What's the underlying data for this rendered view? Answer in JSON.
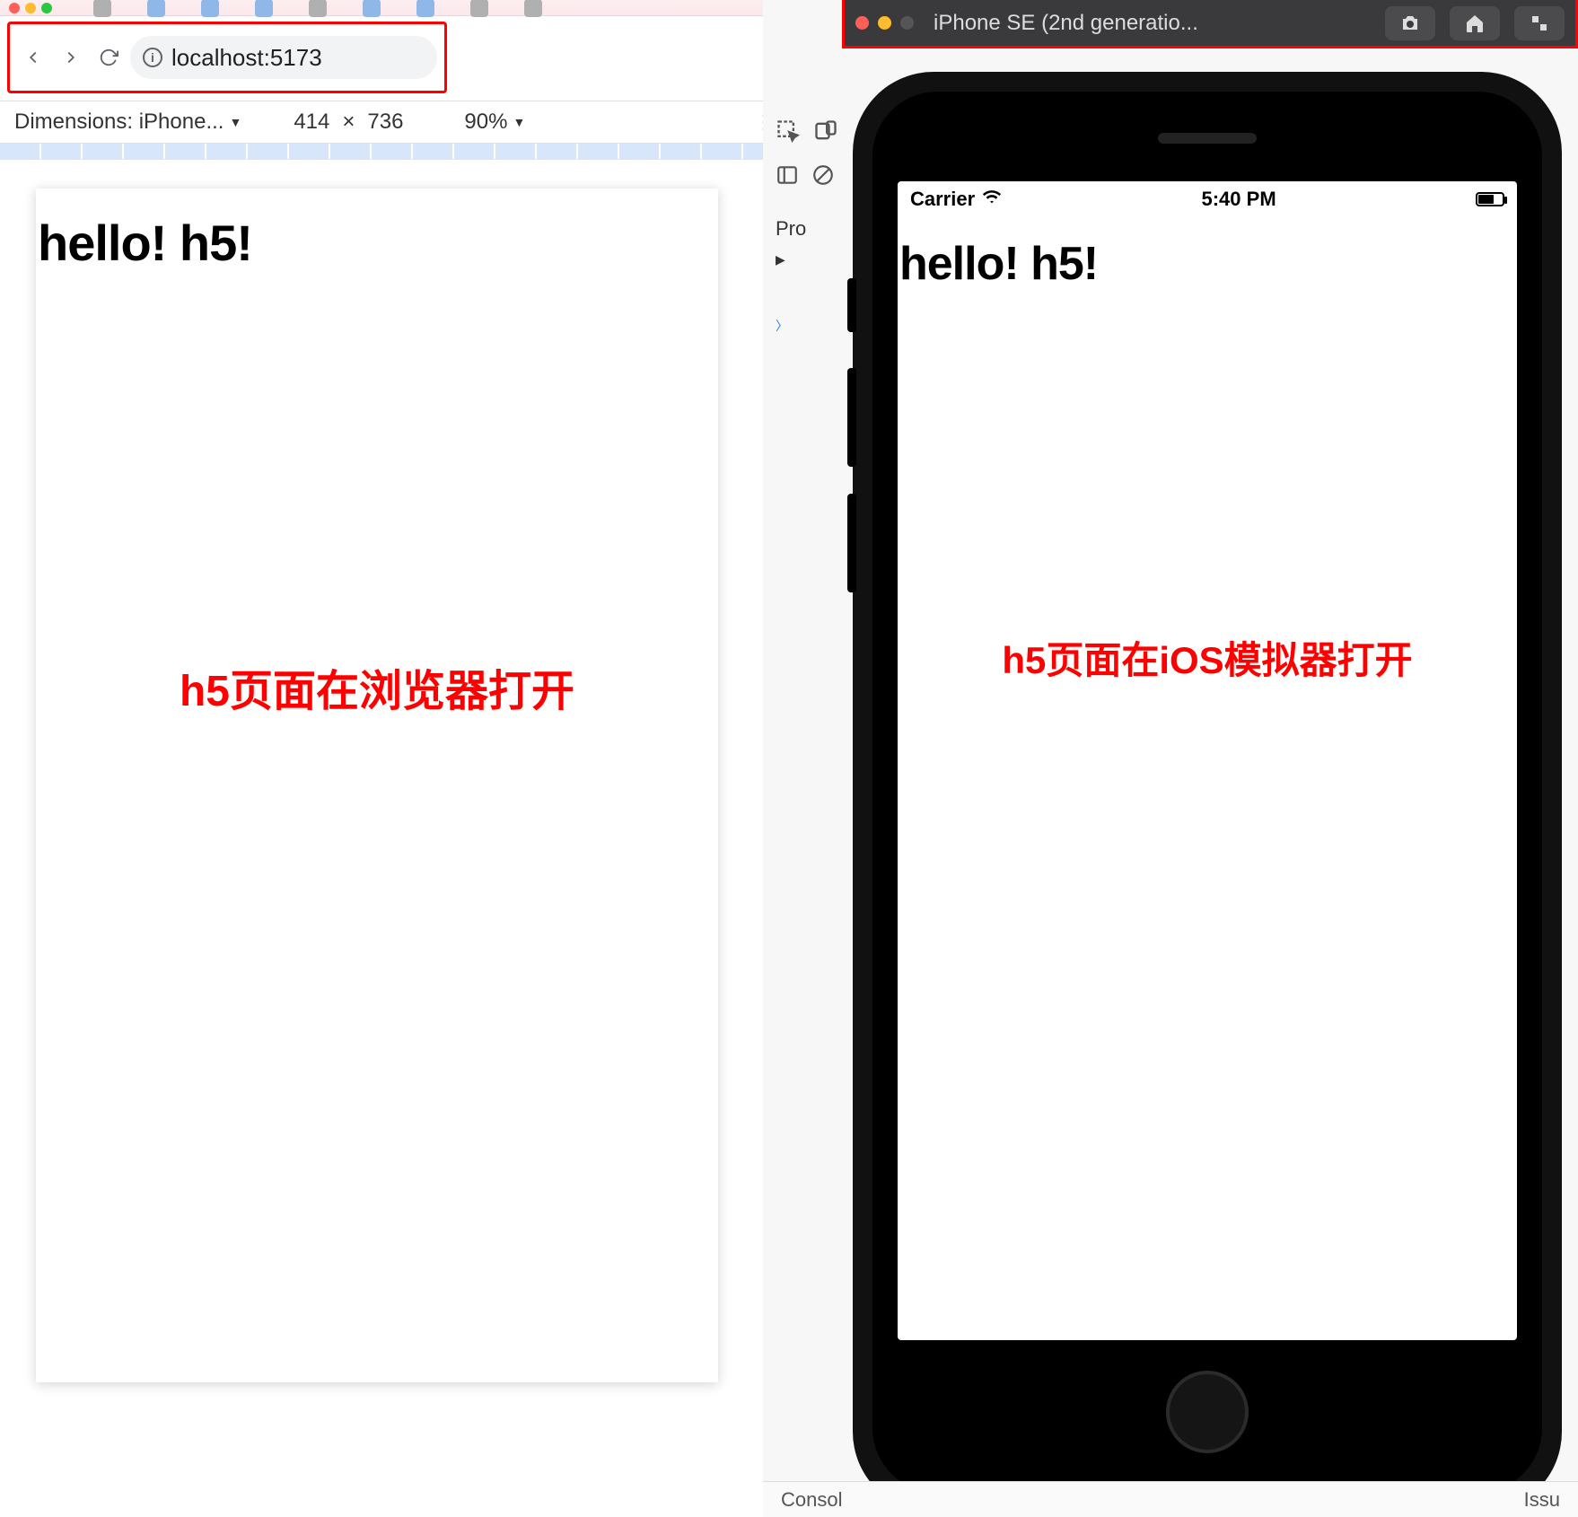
{
  "browser": {
    "url": "localhost:5173",
    "devtools": {
      "dimensions_label": "Dimensions: iPhone...",
      "width": "414",
      "separator": "×",
      "height": "736",
      "zoom": "90%"
    },
    "page_heading": "hello! h5!",
    "caption": "h5页面在浏览器打开"
  },
  "simulator": {
    "window_title": "iPhone SE (2nd generatio...",
    "statusbar": {
      "carrier": "Carrier",
      "time": "5:40 PM"
    },
    "page_heading": "hello! h5!",
    "caption": "h5页面在iOS模拟器打开"
  },
  "xcode_peek": {
    "label": "Pro"
  },
  "bottom": {
    "left": "Consol",
    "right": "Issu"
  }
}
